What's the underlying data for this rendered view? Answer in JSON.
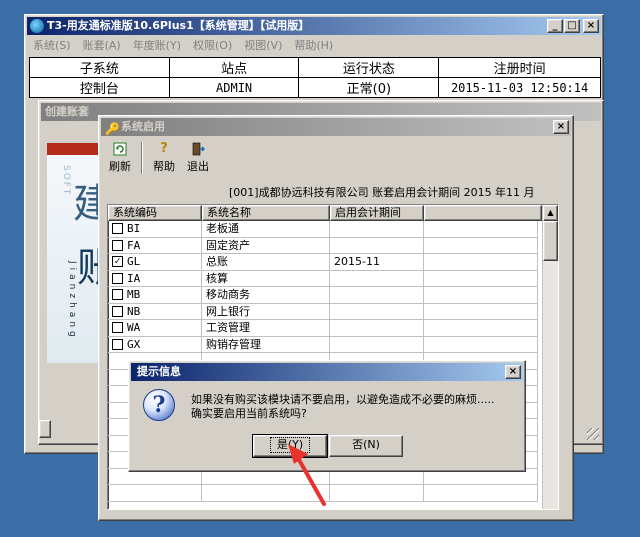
{
  "main_window": {
    "title": "T3-用友通标准版10.6Plus1【系统管理】【试用版】",
    "controls": {
      "minimize": "_",
      "maximize": "□",
      "close": "×"
    }
  },
  "menu": [
    {
      "label": "系统(S)"
    },
    {
      "label": "账套(A)"
    },
    {
      "label": "年度账(Y)"
    },
    {
      "label": "权限(O)"
    },
    {
      "label": "视图(V)"
    },
    {
      "label": "帮助(H)"
    }
  ],
  "status_table": {
    "headers": [
      "子系统",
      "站点",
      "运行状态",
      "注册时间"
    ],
    "row": [
      "控制台",
      "ADMIN",
      "正常(0)",
      "2015-11-03 12:50:14"
    ]
  },
  "create_account_window": {
    "title": "创建账套",
    "banner_char1": "建",
    "banner_char2": "账",
    "banner_vertical": "SOFT",
    "banner_pinyin": "Jianzhang"
  },
  "system_enable_window": {
    "title": "系统启用",
    "close": "×",
    "toolbar": {
      "refresh": "刷新",
      "help": "帮助",
      "exit": "退出"
    },
    "info_line": "[001]成都协远科技有限公司 账套启用会计期间 2015 年11 月",
    "columns": [
      "系统编码",
      "系统名称",
      "启用会计期间"
    ],
    "rows": [
      {
        "code": "BI",
        "name": "老板通",
        "period": "",
        "checked": false
      },
      {
        "code": "FA",
        "name": "固定资产",
        "period": "",
        "checked": false
      },
      {
        "code": "GL",
        "name": "总账",
        "period": "2015-11",
        "checked": true
      },
      {
        "code": "IA",
        "name": "核算",
        "period": "",
        "checked": false
      },
      {
        "code": "MB",
        "name": "移动商务",
        "period": "",
        "checked": false
      },
      {
        "code": "NB",
        "name": "网上银行",
        "period": "",
        "checked": false
      },
      {
        "code": "WA",
        "name": "工资管理",
        "period": "",
        "checked": false
      },
      {
        "code": "GX",
        "name": "购销存管理",
        "period": "",
        "checked": false
      }
    ]
  },
  "prompt_dialog": {
    "title": "提示信息",
    "close": "×",
    "message_line1": "如果没有购买该模块请不要启用，以避免造成不必要的麻烦.....",
    "message_line2": "确实要启用当前系统吗?",
    "yes_label": "是(Y)",
    "no_label": "否(N)"
  },
  "colors": {
    "desktop": "#3b6ea6",
    "titlebar_active": "#0a246a",
    "window_face": "#d4d0c8",
    "annotation_arrow": "#e8322e"
  }
}
